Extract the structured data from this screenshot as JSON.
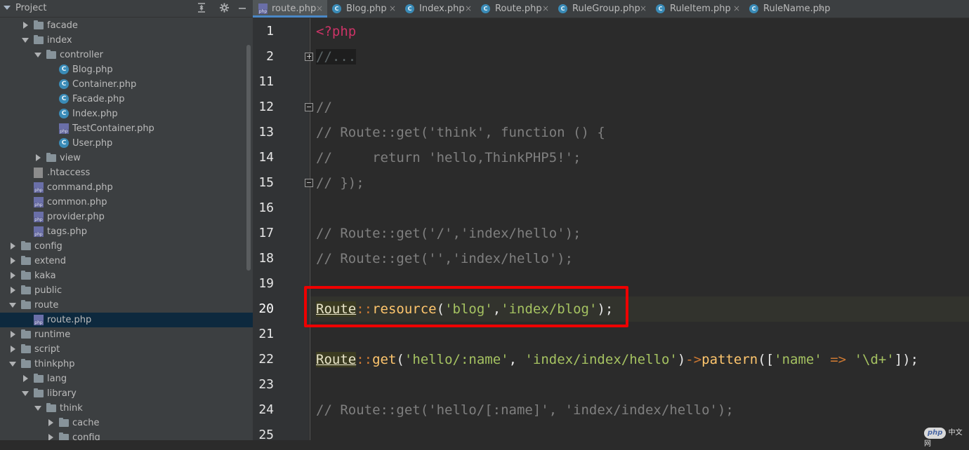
{
  "project": {
    "title": "Project",
    "header_icons": [
      "collapse-icon",
      "gear-icon",
      "minimize-icon"
    ],
    "tree": [
      {
        "label": "facade",
        "kind": "folder",
        "depth": 2,
        "state": "collapsed"
      },
      {
        "label": "index",
        "kind": "folder",
        "depth": 2,
        "state": "expanded"
      },
      {
        "label": "controller",
        "kind": "folder",
        "depth": 3,
        "state": "expanded"
      },
      {
        "label": "Blog.php",
        "kind": "class",
        "depth": 4
      },
      {
        "label": "Container.php",
        "kind": "class",
        "depth": 4
      },
      {
        "label": "Facade.php",
        "kind": "class",
        "depth": 4
      },
      {
        "label": "Index.php",
        "kind": "class",
        "depth": 4
      },
      {
        "label": "TestContainer.php",
        "kind": "php",
        "depth": 4
      },
      {
        "label": "User.php",
        "kind": "class",
        "depth": 4
      },
      {
        "label": "view",
        "kind": "folder",
        "depth": 3,
        "state": "collapsed"
      },
      {
        "label": ".htaccess",
        "kind": "file",
        "depth": 2
      },
      {
        "label": "command.php",
        "kind": "php",
        "depth": 2
      },
      {
        "label": "common.php",
        "kind": "php",
        "depth": 2
      },
      {
        "label": "provider.php",
        "kind": "php",
        "depth": 2
      },
      {
        "label": "tags.php",
        "kind": "php",
        "depth": 2
      },
      {
        "label": "config",
        "kind": "folder",
        "depth": 1,
        "state": "collapsed"
      },
      {
        "label": "extend",
        "kind": "folder",
        "depth": 1,
        "state": "collapsed"
      },
      {
        "label": "kaka",
        "kind": "folder",
        "depth": 1,
        "state": "collapsed"
      },
      {
        "label": "public",
        "kind": "folder",
        "depth": 1,
        "state": "collapsed"
      },
      {
        "label": "route",
        "kind": "folder",
        "depth": 1,
        "state": "expanded"
      },
      {
        "label": "route.php",
        "kind": "php",
        "depth": 2,
        "selected": true
      },
      {
        "label": "runtime",
        "kind": "folder",
        "depth": 1,
        "state": "collapsed"
      },
      {
        "label": "script",
        "kind": "folder",
        "depth": 1,
        "state": "collapsed"
      },
      {
        "label": "thinkphp",
        "kind": "folder",
        "depth": 1,
        "state": "expanded"
      },
      {
        "label": "lang",
        "kind": "folder",
        "depth": 2,
        "state": "collapsed"
      },
      {
        "label": "library",
        "kind": "folder",
        "depth": 2,
        "state": "expanded"
      },
      {
        "label": "think",
        "kind": "folder",
        "depth": 3,
        "state": "expanded"
      },
      {
        "label": "cache",
        "kind": "folder",
        "depth": 4,
        "state": "collapsed"
      },
      {
        "label": "config",
        "kind": "folder",
        "depth": 4,
        "state": "collapsed"
      }
    ]
  },
  "tabs": [
    {
      "label": "route.php",
      "kind": "php",
      "active": true
    },
    {
      "label": "Blog.php",
      "kind": "class"
    },
    {
      "label": "Index.php",
      "kind": "class"
    },
    {
      "label": "Route.php",
      "kind": "class"
    },
    {
      "label": "RuleGroup.php",
      "kind": "class"
    },
    {
      "label": "RuleItem.php",
      "kind": "class"
    },
    {
      "label": "RuleName.php",
      "kind": "class"
    }
  ],
  "tab_close_glyph": "×",
  "editor": {
    "current_line": "20",
    "lines": [
      {
        "num": "1",
        "tokens": [
          {
            "t": "<?php",
            "c": "php"
          }
        ]
      },
      {
        "num": "2",
        "fold": "plus",
        "tokens": [
          {
            "t": "//...",
            "c": "fold"
          }
        ]
      },
      {
        "num": "11",
        "tokens": []
      },
      {
        "num": "12",
        "fold": "minus",
        "tokens": [
          {
            "t": "//",
            "c": "cm"
          }
        ]
      },
      {
        "num": "13",
        "tokens": [
          {
            "t": "// Route::get('think', function () {",
            "c": "cm"
          }
        ]
      },
      {
        "num": "14",
        "tokens": [
          {
            "t": "//     return 'hello,ThinkPHP5!';",
            "c": "cm"
          }
        ]
      },
      {
        "num": "15",
        "fold": "minus",
        "tokens": [
          {
            "t": "// });",
            "c": "cm"
          }
        ]
      },
      {
        "num": "16",
        "tokens": []
      },
      {
        "num": "17",
        "tokens": [
          {
            "t": "// Route::get('/','index/hello');",
            "c": "cm"
          }
        ]
      },
      {
        "num": "18",
        "tokens": [
          {
            "t": "// Route::get('','index/hello');",
            "c": "cm"
          }
        ]
      },
      {
        "num": "19",
        "tokens": []
      },
      {
        "num": "20",
        "tokens": [
          {
            "t": "Route",
            "c": "cls"
          },
          {
            "t": "::",
            "c": "op"
          },
          {
            "t": "resource",
            "c": "fn"
          },
          {
            "t": "(",
            "c": "pun"
          },
          {
            "t": "'blog'",
            "c": "str"
          },
          {
            "t": ",",
            "c": "pun"
          },
          {
            "t": "'index/blog'",
            "c": "str"
          },
          {
            "t": ");",
            "c": "pun"
          }
        ]
      },
      {
        "num": "21",
        "tokens": []
      },
      {
        "num": "22",
        "tokens": [
          {
            "t": "Route",
            "c": "cls"
          },
          {
            "t": "::",
            "c": "op"
          },
          {
            "t": "get",
            "c": "fn"
          },
          {
            "t": "(",
            "c": "pun"
          },
          {
            "t": "'hello/:name'",
            "c": "str"
          },
          {
            "t": ", ",
            "c": "pun"
          },
          {
            "t": "'index/index/hello'",
            "c": "str"
          },
          {
            "t": ")",
            "c": "pun"
          },
          {
            "t": "->",
            "c": "op"
          },
          {
            "t": "pattern",
            "c": "fn"
          },
          {
            "t": "([",
            "c": "pun"
          },
          {
            "t": "'name'",
            "c": "str"
          },
          {
            "t": " ",
            "c": "pun"
          },
          {
            "t": "=>",
            "c": "op"
          },
          {
            "t": " ",
            "c": "pun"
          },
          {
            "t": "'\\d+'",
            "c": "str"
          },
          {
            "t": "]);",
            "c": "pun"
          }
        ]
      },
      {
        "num": "23",
        "tokens": []
      },
      {
        "num": "24",
        "tokens": [
          {
            "t": "// Route::get('hello/[:name]', 'index/index/hello');",
            "c": "cm"
          }
        ]
      },
      {
        "num": "25",
        "tokens": []
      }
    ]
  },
  "watermark": {
    "logo": "php",
    "text": "中文网"
  }
}
